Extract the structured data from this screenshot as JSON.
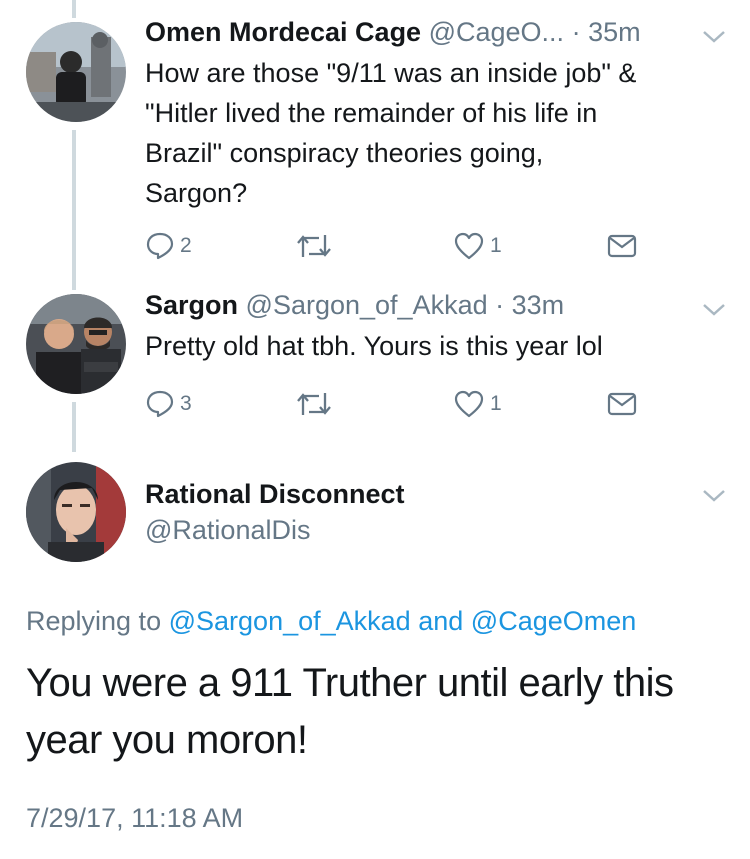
{
  "colors": {
    "text": "#14171a",
    "secondary": "#657786",
    "link": "#1b95e0",
    "thread_line": "#cfd9de",
    "icon": "#657786"
  },
  "tweets": [
    {
      "avatar": "avatar-omen",
      "name": "Omen Mordecai Cage",
      "handle": "@CageO...",
      "separator": "·",
      "time": "35m",
      "text_lines": [
        "How are those \"9/11 was an inside job\" &",
        "\"Hitler lived the remainder of his life in",
        "Brazil\" conspiracy theories going,",
        "Sargon?"
      ],
      "replies": "2",
      "retweets": "",
      "likes": "1"
    },
    {
      "avatar": "avatar-sargon",
      "name": "Sargon",
      "handle": "@Sargon_of_Akkad",
      "separator": "·",
      "time": "33m",
      "text_lines": [
        "Pretty old hat tbh. Yours is this year lol"
      ],
      "replies": "3",
      "retweets": "",
      "likes": "1"
    }
  ],
  "main_tweet": {
    "name": "Rational Disconnect",
    "handle": "@RationalDis",
    "replying_prefix": "Replying to",
    "replying_user1": "@Sargon_of_Akkad",
    "replying_and": "and",
    "replying_user2": "@CageOmen",
    "text_lines": [
      "You were a 911 Truther until early this",
      "year you moron!"
    ],
    "timestamp": "7/29/17, 11:18 AM"
  }
}
